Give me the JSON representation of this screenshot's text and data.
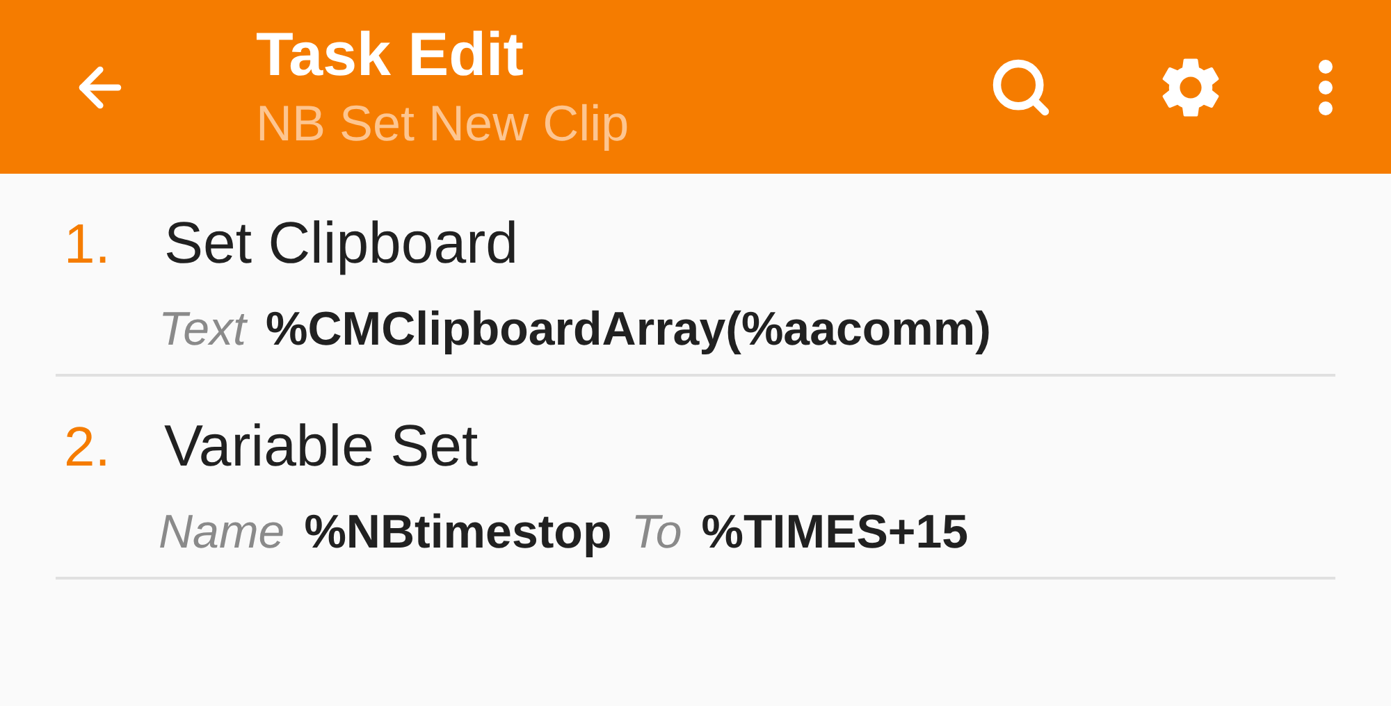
{
  "header": {
    "title": "Task Edit",
    "subtitle": "NB Set New Clip"
  },
  "actions": [
    {
      "number": "1.",
      "name": "Set Clipboard",
      "params": [
        {
          "label": "Text",
          "value": "%CMClipboardArray(%aacomm)"
        }
      ]
    },
    {
      "number": "2.",
      "name": "Variable Set",
      "params": [
        {
          "label": "Name",
          "value": "%NBtimestop"
        },
        {
          "label": "To",
          "value": "%TIMES+15"
        }
      ]
    }
  ]
}
